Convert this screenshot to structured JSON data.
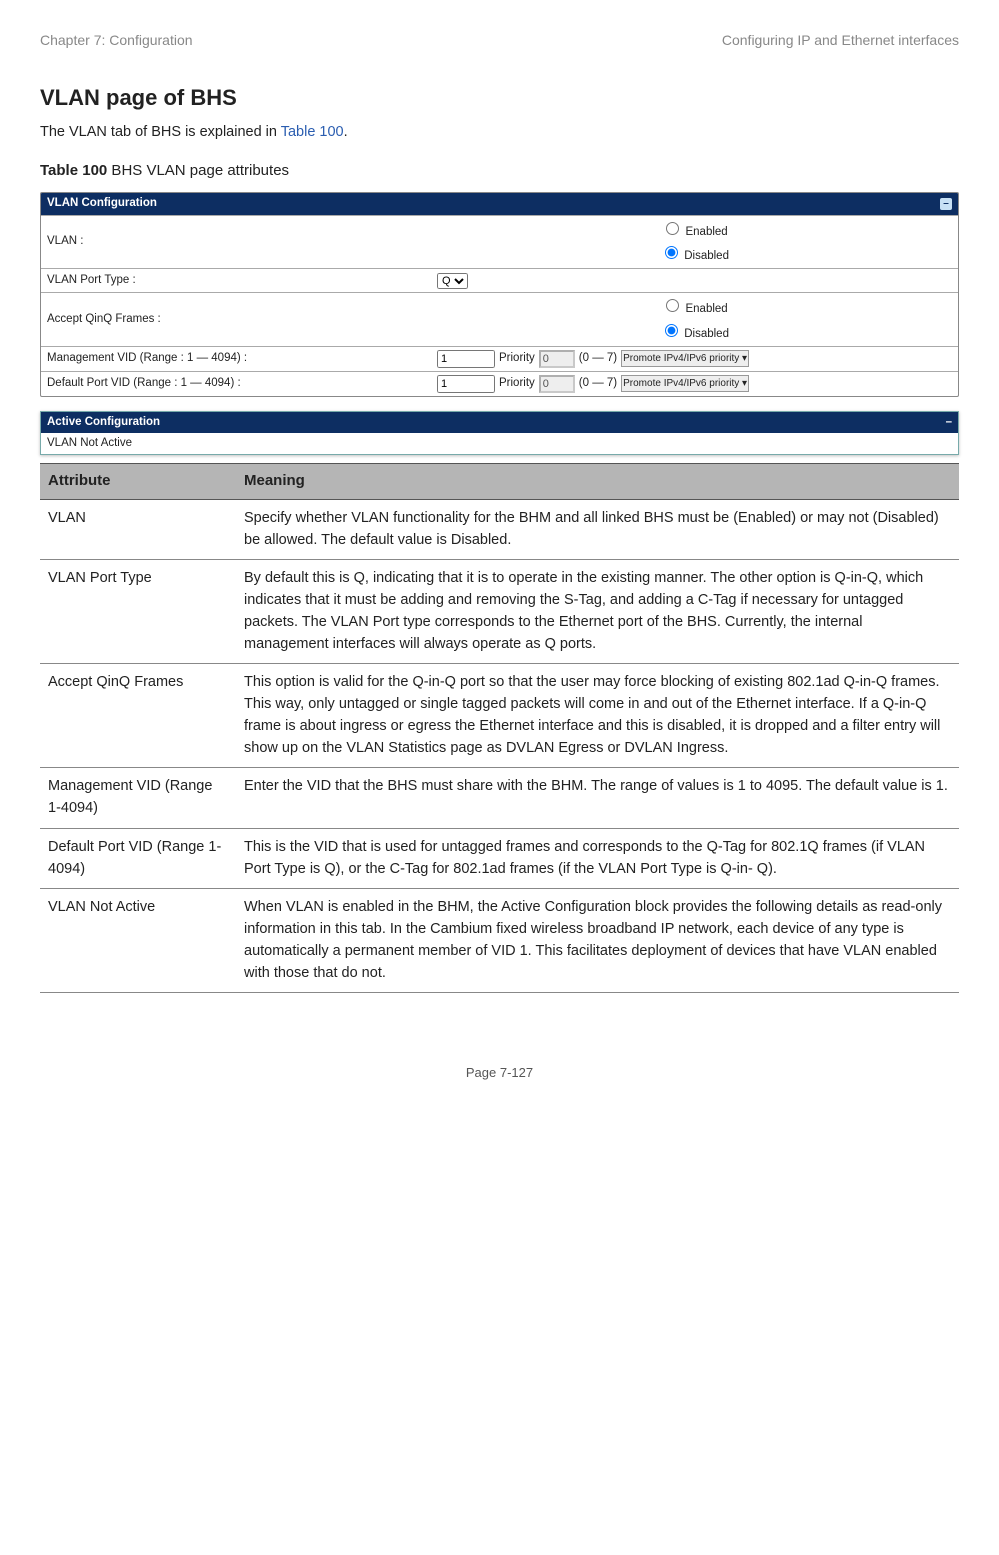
{
  "header": {
    "chapter": "Chapter 7:  Configuration",
    "section": "Configuring IP and Ethernet interfaces"
  },
  "title": "VLAN page of BHS",
  "intro_pre": "The VLAN tab of BHS is explained in ",
  "intro_link": "Table 100",
  "intro_post": ".",
  "table_caption_bold": "Table 100",
  "table_caption_rest": " BHS VLAN page attributes",
  "cfg": {
    "panel_title": "VLAN Configuration",
    "vlan_label": "VLAN :",
    "enabled": "Enabled",
    "disabled": "Disabled",
    "port_type_label": "VLAN Port Type :",
    "port_type_value": "Q",
    "accept_qinq_label": "Accept QinQ Frames :",
    "mgmt_vid_label": "Management VID (Range : 1 — 4094) :",
    "default_vid_label": "Default Port VID (Range : 1 — 4094) :",
    "vid_value": "1",
    "priority_label": "Priority",
    "priority_value": "0",
    "priority_range": "(0 — 7)",
    "promote_select": "Promote IPv4/IPv6 priority"
  },
  "active": {
    "title": "Active Configuration",
    "body": "VLAN Not Active"
  },
  "columns": {
    "attr": "Attribute",
    "meaning": "Meaning"
  },
  "rows": [
    {
      "attr": "VLAN",
      "meaning": "Specify whether VLAN functionality for the BHM and all linked BHS must be (Enabled) or may not (Disabled) be allowed. The default value is Disabled."
    },
    {
      "attr": "VLAN Port Type",
      "meaning": "By default this is Q, indicating that it is to operate in the existing manner. The other option is Q-in-Q, which indicates that it must be adding and removing the S-Tag, and adding a C-Tag if necessary for untagged packets. The VLAN Port type corresponds to the Ethernet port of the BHS. Currently, the internal management interfaces will always operate as Q ports."
    },
    {
      "attr": "Accept QinQ Frames",
      "meaning": "This option is valid for the Q-in-Q port so that the user may force blocking of existing 802.1ad Q-in-Q frames. This way, only untagged or single tagged packets will come in and out of the Ethernet interface. If a Q-in-Q frame is about ingress or egress the Ethernet interface and this is disabled, it is dropped and a filter entry will show up on the VLAN Statistics page as DVLAN Egress or DVLAN Ingress."
    },
    {
      "attr": "Management VID (Range 1-4094)",
      "meaning": "Enter the VID that the BHS must share with the BHM. The range of values is 1 to 4095. The default value is 1."
    },
    {
      "attr": "Default Port VID (Range 1-4094)",
      "meaning": "This is the VID that is used for untagged frames and corresponds to the Q-Tag for 802.1Q frames (if VLAN Port Type is Q), or the C-Tag for 802.1ad frames (if the VLAN Port Type is Q-in- Q)."
    },
    {
      "attr": "VLAN Not Active",
      "meaning": "When VLAN is enabled in the BHM, the Active Configuration block provides the following details as read-only information in this tab. In the Cambium fixed wireless broadband IP network, each device of any type is automatically a permanent member of VID 1. This facilitates deployment of devices that have VLAN enabled with those that do not."
    }
  ],
  "footer": "Page 7-127"
}
